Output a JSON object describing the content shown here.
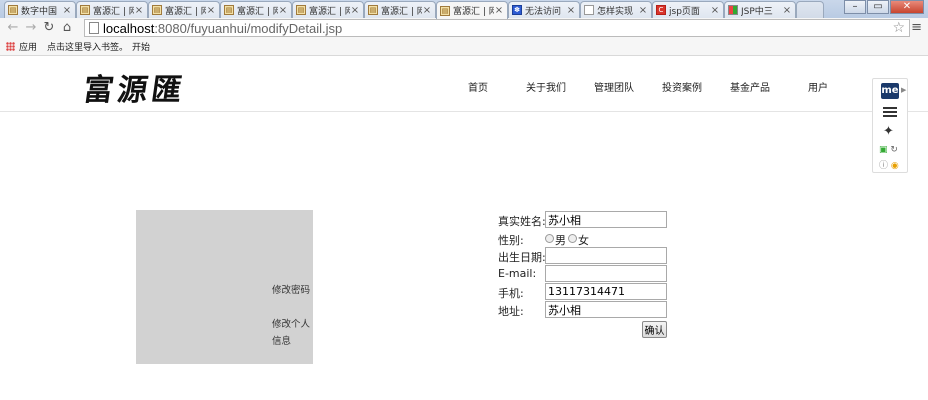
{
  "browser": {
    "tabs": [
      {
        "title": "数字中国",
        "icon": "page-icon"
      },
      {
        "title": "富源汇 | 网",
        "icon": "page-icon"
      },
      {
        "title": "富源汇 | 网",
        "icon": "page-icon"
      },
      {
        "title": "富源汇 | 网",
        "icon": "page-icon"
      },
      {
        "title": "富源汇 | 网",
        "icon": "page-icon"
      },
      {
        "title": "富源汇 | 网",
        "icon": "page-icon"
      },
      {
        "title": "富源汇 | 网",
        "icon": "page-icon"
      },
      {
        "title": "无法访问",
        "icon": "baidu-icon"
      },
      {
        "title": "怎样实现",
        "icon": "document-icon"
      },
      {
        "title": "jsp页面",
        "icon": "c-icon"
      },
      {
        "title": "JSP中三",
        "icon": "msft-icon"
      }
    ],
    "active_tab": 6,
    "url_host": "localhost",
    "url_rest": ":8080/fuyuanhui/modifyDetail.jsp",
    "bookmarks": {
      "apps_label": "应用",
      "import_label": "点击这里导入书签。",
      "start_label": "开始"
    }
  },
  "site": {
    "logo": "富源匯",
    "nav": [
      "首页",
      "关于我们",
      "管理团队",
      "投资案例",
      "基金产品",
      "用户"
    ]
  },
  "extension": {
    "badge": "me"
  },
  "sidebar": {
    "change_password": "修改密码",
    "change_info_line1": "修改个人",
    "change_info_line2": "信息"
  },
  "form": {
    "real_name_label": "真实姓名:",
    "real_name_value": "苏小相",
    "gender_label": "性别:",
    "gender_options": [
      "男",
      "女"
    ],
    "birth_label": "出生日期:",
    "birth_value": "",
    "email_label": "E-mail:",
    "email_value": "",
    "phone_label": "手机:",
    "phone_value": "13117314471",
    "address_label": "地址:",
    "address_value": "苏小相",
    "submit_label": "确认"
  }
}
